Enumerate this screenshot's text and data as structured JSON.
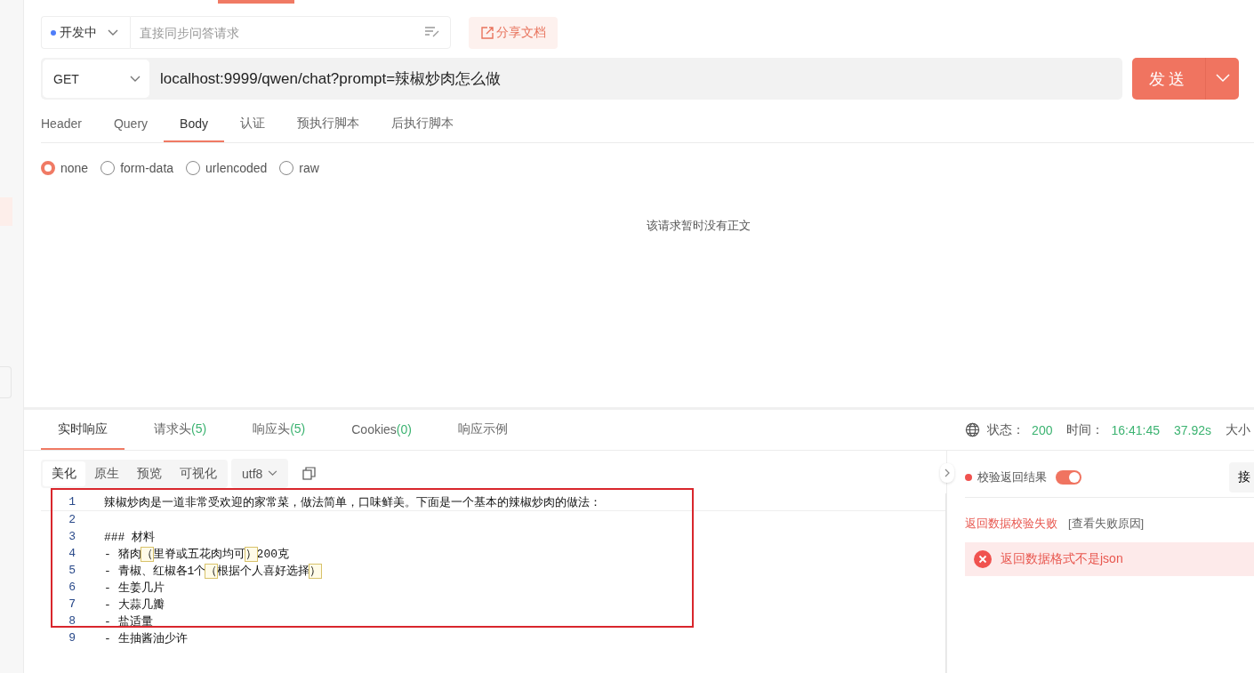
{
  "toolbar": {
    "environment": "开发中",
    "placeholder": "直接同步问答请求",
    "share_button": "分享文档"
  },
  "request": {
    "method": "GET",
    "url": "localhost:9999/qwen/chat?prompt=辣椒炒肉怎么做",
    "send_button": "发送"
  },
  "request_tabs": [
    {
      "label": "Header",
      "selected": false
    },
    {
      "label": "Query",
      "selected": false
    },
    {
      "label": "Body",
      "selected": true
    },
    {
      "label": "认证",
      "selected": false
    },
    {
      "label": "预执行脚本",
      "selected": false
    },
    {
      "label": "后执行脚本",
      "selected": false
    }
  ],
  "body_types": [
    {
      "label": "none",
      "selected": true
    },
    {
      "label": "form-data",
      "selected": false
    },
    {
      "label": "urlencoded",
      "selected": false
    },
    {
      "label": "raw",
      "selected": false
    }
  ],
  "empty_body": "该请求暂时没有正文",
  "response_tabs": [
    {
      "label": "实时响应",
      "selected": true
    },
    {
      "label": "请求头",
      "count": "(5)",
      "selected": false
    },
    {
      "label": "响应头",
      "count": "(5)",
      "selected": false
    },
    {
      "label": "Cookies",
      "count": "(0)",
      "selected": false
    },
    {
      "label": "响应示例",
      "selected": false
    }
  ],
  "status": {
    "status_label": "状态：",
    "status": "200",
    "time_label": "时间：",
    "time": "16:41:45",
    "duration": "37.92s",
    "size_label": "大小"
  },
  "view_tabs": [
    {
      "label": "美化",
      "selected": true
    },
    {
      "label": "原生",
      "selected": false
    },
    {
      "label": "预览",
      "selected": false
    },
    {
      "label": "可视化",
      "selected": false
    }
  ],
  "encoding": "utf8",
  "code_lines": [
    {
      "number": "1",
      "segments": [
        {
          "text": "辣椒炒肉是一道非常受欢迎的家常菜，做法简单，口味鲜美。下面是一个基本的辣椒炒肉的做法：",
          "highlighted": false
        }
      ]
    },
    {
      "number": "2"
    },
    {
      "number": "3",
      "segments": [
        {
          "text": "### 材料",
          "highlighted": false
        }
      ]
    },
    {
      "number": "4",
      "segments": [
        {
          "text": "- 猪肉",
          "highlighted": false
        },
        {
          "text": "（",
          "highlighted": true
        },
        {
          "text": "里脊或五花肉均可",
          "highlighted": false
        },
        {
          "text": "）",
          "highlighted": true
        },
        {
          "text": "200克",
          "highlighted": false
        }
      ]
    },
    {
      "number": "5",
      "segments": [
        {
          "text": "- 青椒、红椒各1个",
          "highlighted": false
        },
        {
          "text": "（",
          "highlighted": true
        },
        {
          "text": "根据个人喜好选择",
          "highlighted": false
        },
        {
          "text": "）",
          "highlighted": true
        }
      ]
    },
    {
      "number": "6",
      "segments": [
        {
          "text": "- 生姜几片",
          "highlighted": false
        }
      ]
    },
    {
      "number": "7",
      "segments": [
        {
          "text": "- 大蒜几瓣",
          "highlighted": false
        }
      ]
    },
    {
      "number": "8",
      "segments": [
        {
          "text": "- 盐适量",
          "highlighted": false
        }
      ]
    },
    {
      "number": "9",
      "segments": [
        {
          "text": "- 生抽酱油少许",
          "highlighted": false
        }
      ]
    }
  ],
  "validation": {
    "label": "校验返回结果",
    "enabled": true,
    "side_button": "接",
    "result": "返回数据校验失败",
    "link": "[查看失败原因]",
    "error": "返回数据格式不是json"
  }
}
